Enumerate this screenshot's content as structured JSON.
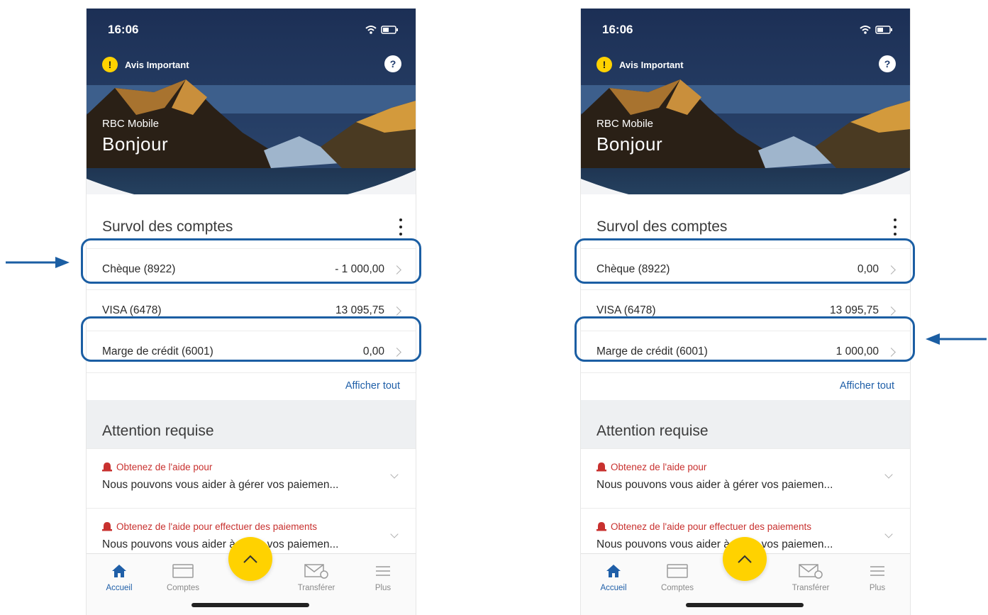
{
  "colors": {
    "accent_blue": "#1b5ea3",
    "brand_yellow": "#ffd200",
    "alert_red": "#c8312f",
    "link_blue": "#1f5fa8"
  },
  "screens": [
    {
      "status": {
        "time": "16:06"
      },
      "notice": {
        "icon": "!",
        "label": "Avis Important"
      },
      "help_icon": "?",
      "header": {
        "brand": "RBC Mobile",
        "greeting": "Bonjour"
      },
      "accounts": {
        "title": "Survol des comptes",
        "items": [
          {
            "name": "Chèque (8922)",
            "amount": "- 1 000,00"
          },
          {
            "name": "VISA (6478)",
            "amount": "13 095,75"
          },
          {
            "name": "Marge de crédit (6001)",
            "amount": "0,00"
          }
        ],
        "show_all": "Afficher tout"
      },
      "attention": {
        "title": "Attention requise",
        "alerts": [
          {
            "title": "Obtenez de l'aide pour",
            "desc": "Nous pouvons vous aider à gérer vos paiemen..."
          },
          {
            "title": "Obtenez de l'aide pour effectuer des paiements",
            "desc": "Nous pouvons vous aider à gérer vos paiemen..."
          }
        ]
      },
      "nav": {
        "items": [
          "Accueil",
          "Comptes",
          "Transférer",
          "Plus"
        ]
      }
    },
    {
      "status": {
        "time": "16:06"
      },
      "notice": {
        "icon": "!",
        "label": "Avis Important"
      },
      "help_icon": "?",
      "header": {
        "brand": "RBC Mobile",
        "greeting": "Bonjour"
      },
      "accounts": {
        "title": "Survol des comptes",
        "items": [
          {
            "name": "Chèque (8922)",
            "amount": "0,00"
          },
          {
            "name": "VISA (6478)",
            "amount": "13 095,75"
          },
          {
            "name": "Marge de crédit (6001)",
            "amount": "1 000,00"
          }
        ],
        "show_all": "Afficher tout"
      },
      "attention": {
        "title": "Attention requise",
        "alerts": [
          {
            "title": "Obtenez de l'aide pour",
            "desc": "Nous pouvons vous aider à gérer vos paiemen..."
          },
          {
            "title": "Obtenez de l'aide pour effectuer des paiements",
            "desc": "Nous pouvons vous aider à gérer vos paiemen..."
          }
        ]
      },
      "nav": {
        "items": [
          "Accueil",
          "Comptes",
          "Transférer",
          "Plus"
        ]
      }
    }
  ]
}
